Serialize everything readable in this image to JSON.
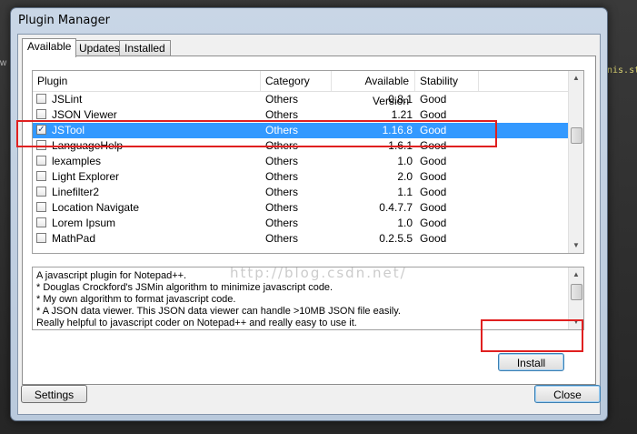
{
  "window": {
    "title": "Plugin Manager"
  },
  "tabs": [
    {
      "label": "Available",
      "active": true
    },
    {
      "label": "Updates",
      "active": false
    },
    {
      "label": "Installed",
      "active": false
    }
  ],
  "columns": {
    "plugin": "Plugin",
    "category": "Category",
    "version": "Available Version",
    "stability": "Stability"
  },
  "plugins": [
    {
      "name": "JSLint",
      "category": "Others",
      "version": "0.8.1",
      "stability": "Good",
      "checked": false,
      "selected": false
    },
    {
      "name": "JSON Viewer",
      "category": "Others",
      "version": "1.21",
      "stability": "Good",
      "checked": false,
      "selected": false
    },
    {
      "name": "JSTool",
      "category": "Others",
      "version": "1.16.8",
      "stability": "Good",
      "checked": true,
      "selected": true
    },
    {
      "name": "LanguageHelp",
      "category": "Others",
      "version": "1.6.1",
      "stability": "Good",
      "checked": false,
      "selected": false
    },
    {
      "name": "lexamples",
      "category": "Others",
      "version": "1.0",
      "stability": "Good",
      "checked": false,
      "selected": false
    },
    {
      "name": "Light Explorer",
      "category": "Others",
      "version": "2.0",
      "stability": "Good",
      "checked": false,
      "selected": false
    },
    {
      "name": "Linefilter2",
      "category": "Others",
      "version": "1.1",
      "stability": "Good",
      "checked": false,
      "selected": false
    },
    {
      "name": "Location Navigate",
      "category": "Others",
      "version": "0.4.7.7",
      "stability": "Good",
      "checked": false,
      "selected": false
    },
    {
      "name": "Lorem Ipsum",
      "category": "Others",
      "version": "1.0",
      "stability": "Good",
      "checked": false,
      "selected": false
    },
    {
      "name": "MathPad",
      "category": "Others",
      "version": "0.2.5.5",
      "stability": "Good",
      "checked": false,
      "selected": false
    }
  ],
  "description": [
    "A javascript plugin for Notepad++.",
    " * Douglas Crockford's JSMin algorithm to minimize javascript code.",
    " * My own algorithm to format javascript code.",
    " * A JSON data viewer. This JSON data viewer can handle >10MB JSON file easily.",
    "Really helpful to javascript coder on Notepad++ and really easy to use it."
  ],
  "watermark": "http://blog.csdn.net/",
  "buttons": {
    "install": "Install",
    "settings": "Settings",
    "close": "Close"
  },
  "background": {
    "left_text": "w",
    "right_text": "nis.st"
  },
  "colors": {
    "selection": "#3399ff",
    "highlight_box": "#e02020"
  }
}
